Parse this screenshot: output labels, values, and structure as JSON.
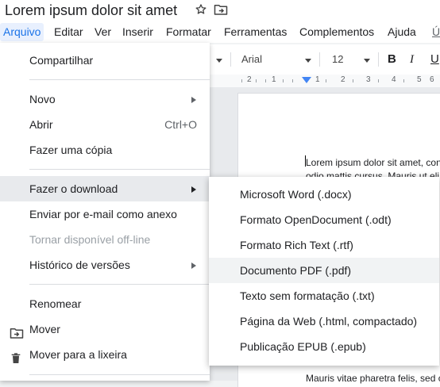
{
  "document": {
    "title": "Lorem ipsum dolor sit amet"
  },
  "menubar": [
    "Arquivo",
    "Editar",
    "Ver",
    "Inserir",
    "Formatar",
    "Ferramentas",
    "Complementos",
    "Ajuda",
    "Ú"
  ],
  "toolbar": {
    "font": "Arial",
    "size": "12",
    "bold": "B",
    "italic": "I",
    "underline": "U"
  },
  "ruler": [
    "2",
    "1",
    "1",
    "2",
    "3",
    "4",
    "5",
    "6"
  ],
  "file_menu": {
    "share": "Compartilhar",
    "new": "Novo",
    "open": "Abrir",
    "open_shortcut": "Ctrl+O",
    "copy": "Fazer uma cópia",
    "download": "Fazer o download",
    "email": "Enviar por e-mail como anexo",
    "offline": "Tornar disponível off-line",
    "history": "Histórico de versões",
    "rename": "Renomear",
    "move": "Mover",
    "trash": "Mover para a lixeira"
  },
  "download_menu": [
    "Microsoft Word (.docx)",
    "Formato OpenDocument (.odt)",
    "Formato Rich Text (.rtf)",
    "Documento PDF (.pdf)",
    "Texto sem formatação (.txt)",
    "Página da Web (.html, compactado)",
    "Publicação EPUB (.epub)"
  ],
  "page_text": {
    "line1": "Lorem ipsum dolor sit amet, con",
    "line2": "odio mattis cursus. Mauris ut eli",
    "line3": "Mauris vitae pharetra felis, sed c"
  },
  "colors": {
    "accent": "#1a73e8",
    "ruler_marker": "#4285f4"
  }
}
